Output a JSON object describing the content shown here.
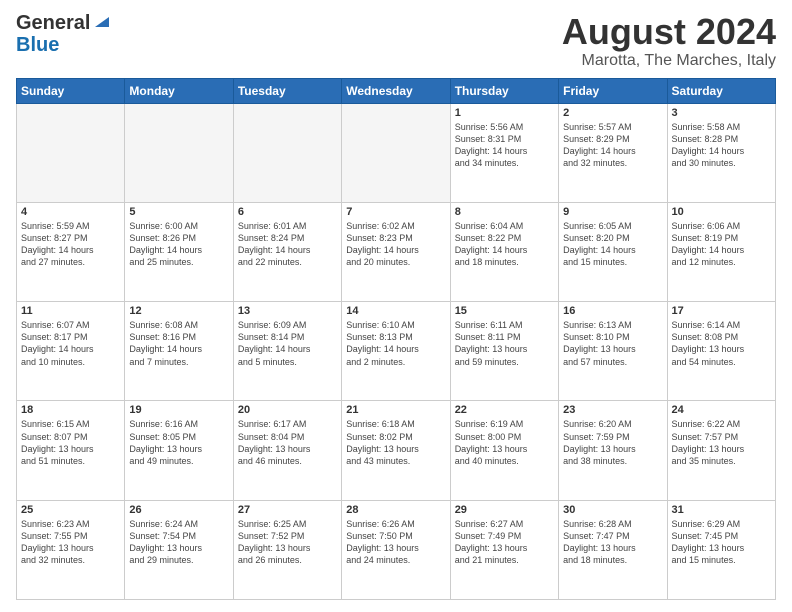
{
  "header": {
    "logo_general": "General",
    "logo_blue": "Blue",
    "month_title": "August 2024",
    "location": "Marotta, The Marches, Italy"
  },
  "weekdays": [
    "Sunday",
    "Monday",
    "Tuesday",
    "Wednesday",
    "Thursday",
    "Friday",
    "Saturday"
  ],
  "weeks": [
    [
      {
        "day": "",
        "info": ""
      },
      {
        "day": "",
        "info": ""
      },
      {
        "day": "",
        "info": ""
      },
      {
        "day": "",
        "info": ""
      },
      {
        "day": "1",
        "info": "Sunrise: 5:56 AM\nSunset: 8:31 PM\nDaylight: 14 hours\nand 34 minutes."
      },
      {
        "day": "2",
        "info": "Sunrise: 5:57 AM\nSunset: 8:29 PM\nDaylight: 14 hours\nand 32 minutes."
      },
      {
        "day": "3",
        "info": "Sunrise: 5:58 AM\nSunset: 8:28 PM\nDaylight: 14 hours\nand 30 minutes."
      }
    ],
    [
      {
        "day": "4",
        "info": "Sunrise: 5:59 AM\nSunset: 8:27 PM\nDaylight: 14 hours\nand 27 minutes."
      },
      {
        "day": "5",
        "info": "Sunrise: 6:00 AM\nSunset: 8:26 PM\nDaylight: 14 hours\nand 25 minutes."
      },
      {
        "day": "6",
        "info": "Sunrise: 6:01 AM\nSunset: 8:24 PM\nDaylight: 14 hours\nand 22 minutes."
      },
      {
        "day": "7",
        "info": "Sunrise: 6:02 AM\nSunset: 8:23 PM\nDaylight: 14 hours\nand 20 minutes."
      },
      {
        "day": "8",
        "info": "Sunrise: 6:04 AM\nSunset: 8:22 PM\nDaylight: 14 hours\nand 18 minutes."
      },
      {
        "day": "9",
        "info": "Sunrise: 6:05 AM\nSunset: 8:20 PM\nDaylight: 14 hours\nand 15 minutes."
      },
      {
        "day": "10",
        "info": "Sunrise: 6:06 AM\nSunset: 8:19 PM\nDaylight: 14 hours\nand 12 minutes."
      }
    ],
    [
      {
        "day": "11",
        "info": "Sunrise: 6:07 AM\nSunset: 8:17 PM\nDaylight: 14 hours\nand 10 minutes."
      },
      {
        "day": "12",
        "info": "Sunrise: 6:08 AM\nSunset: 8:16 PM\nDaylight: 14 hours\nand 7 minutes."
      },
      {
        "day": "13",
        "info": "Sunrise: 6:09 AM\nSunset: 8:14 PM\nDaylight: 14 hours\nand 5 minutes."
      },
      {
        "day": "14",
        "info": "Sunrise: 6:10 AM\nSunset: 8:13 PM\nDaylight: 14 hours\nand 2 minutes."
      },
      {
        "day": "15",
        "info": "Sunrise: 6:11 AM\nSunset: 8:11 PM\nDaylight: 13 hours\nand 59 minutes."
      },
      {
        "day": "16",
        "info": "Sunrise: 6:13 AM\nSunset: 8:10 PM\nDaylight: 13 hours\nand 57 minutes."
      },
      {
        "day": "17",
        "info": "Sunrise: 6:14 AM\nSunset: 8:08 PM\nDaylight: 13 hours\nand 54 minutes."
      }
    ],
    [
      {
        "day": "18",
        "info": "Sunrise: 6:15 AM\nSunset: 8:07 PM\nDaylight: 13 hours\nand 51 minutes."
      },
      {
        "day": "19",
        "info": "Sunrise: 6:16 AM\nSunset: 8:05 PM\nDaylight: 13 hours\nand 49 minutes."
      },
      {
        "day": "20",
        "info": "Sunrise: 6:17 AM\nSunset: 8:04 PM\nDaylight: 13 hours\nand 46 minutes."
      },
      {
        "day": "21",
        "info": "Sunrise: 6:18 AM\nSunset: 8:02 PM\nDaylight: 13 hours\nand 43 minutes."
      },
      {
        "day": "22",
        "info": "Sunrise: 6:19 AM\nSunset: 8:00 PM\nDaylight: 13 hours\nand 40 minutes."
      },
      {
        "day": "23",
        "info": "Sunrise: 6:20 AM\nSunset: 7:59 PM\nDaylight: 13 hours\nand 38 minutes."
      },
      {
        "day": "24",
        "info": "Sunrise: 6:22 AM\nSunset: 7:57 PM\nDaylight: 13 hours\nand 35 minutes."
      }
    ],
    [
      {
        "day": "25",
        "info": "Sunrise: 6:23 AM\nSunset: 7:55 PM\nDaylight: 13 hours\nand 32 minutes."
      },
      {
        "day": "26",
        "info": "Sunrise: 6:24 AM\nSunset: 7:54 PM\nDaylight: 13 hours\nand 29 minutes."
      },
      {
        "day": "27",
        "info": "Sunrise: 6:25 AM\nSunset: 7:52 PM\nDaylight: 13 hours\nand 26 minutes."
      },
      {
        "day": "28",
        "info": "Sunrise: 6:26 AM\nSunset: 7:50 PM\nDaylight: 13 hours\nand 24 minutes."
      },
      {
        "day": "29",
        "info": "Sunrise: 6:27 AM\nSunset: 7:49 PM\nDaylight: 13 hours\nand 21 minutes."
      },
      {
        "day": "30",
        "info": "Sunrise: 6:28 AM\nSunset: 7:47 PM\nDaylight: 13 hours\nand 18 minutes."
      },
      {
        "day": "31",
        "info": "Sunrise: 6:29 AM\nSunset: 7:45 PM\nDaylight: 13 hours\nand 15 minutes."
      }
    ]
  ]
}
